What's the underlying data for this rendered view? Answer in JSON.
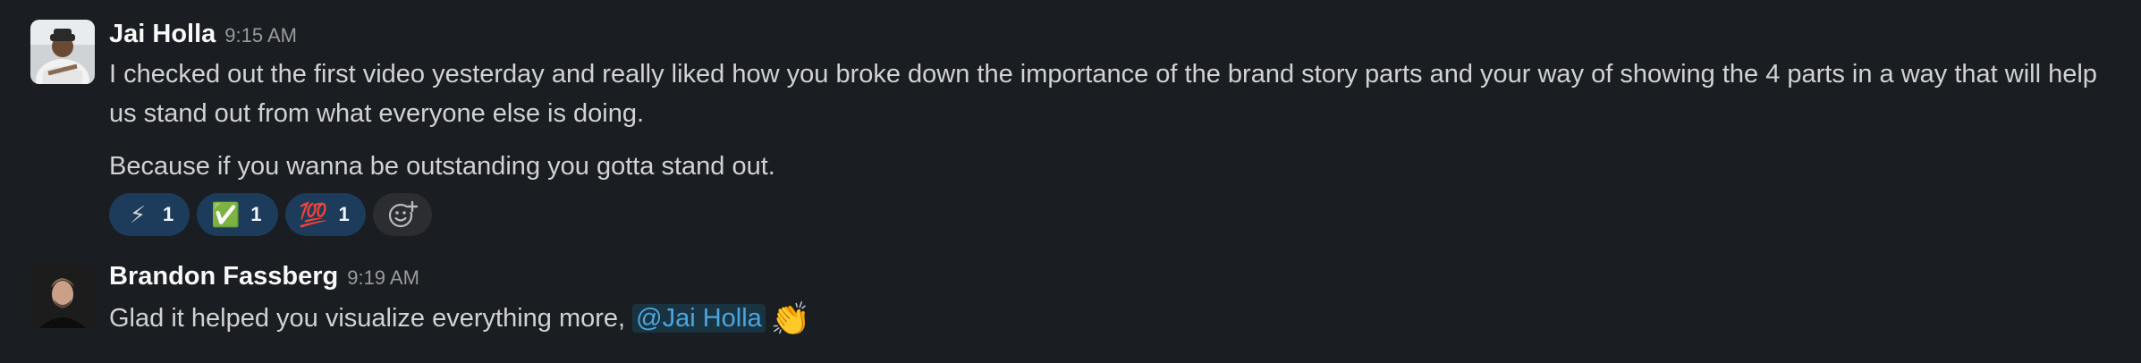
{
  "messages": [
    {
      "author": "Jai Holla",
      "time": "9:15 AM",
      "paragraph1": "I checked out the first video yesterday and really liked how you broke down the importance of the brand story parts and your way of showing the 4 parts in a way that will help us stand out from what everyone else is doing.",
      "paragraph2": "Because if you wanna be outstanding you gotta stand out.",
      "reactions": [
        {
          "emoji": "⚡",
          "icon": "high-voltage-emoji",
          "count": "1"
        },
        {
          "emoji": "✅",
          "icon": "check-mark-button-emoji",
          "count": "1"
        },
        {
          "emoji": "💯",
          "icon": "hundred-points-emoji",
          "count": "1"
        }
      ],
      "add_reaction_icon": "add-reaction-icon"
    },
    {
      "author": "Brandon Fassberg",
      "time": "9:19 AM",
      "text": "Glad it helped you visualize everything more,",
      "mention": "@Jai Holla",
      "trailing_emoji": "👏",
      "trailing_emoji_icon": "clapping-hands-emoji"
    }
  ],
  "colors": {
    "background": "#1a1d21",
    "reaction_bg": "#1d3c5c",
    "mention": "#4aa6e0"
  }
}
